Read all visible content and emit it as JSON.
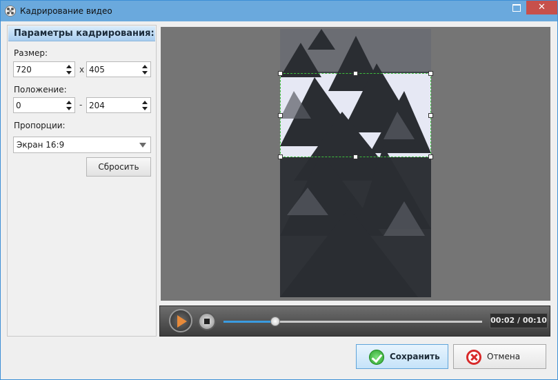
{
  "window": {
    "title": "Кадрирование видео",
    "icons": {
      "app": "film-reel-icon",
      "restore": "restore-window-icon",
      "close": "close-icon"
    }
  },
  "crop_panel": {
    "header": "Параметры кадрирования:",
    "size_label": "Размер:",
    "width": "720",
    "size_separator": "x",
    "height": "405",
    "position_label": "Положение:",
    "pos_x": "0",
    "position_separator": "-",
    "pos_y": "204",
    "ratio_label": "Пропорции:",
    "ratio_value": "Экран 16:9",
    "reset_label": "Сбросить"
  },
  "player": {
    "time": "00:02 / 00:10",
    "progress": 0.2
  },
  "footer": {
    "save_label": "Сохранить",
    "cancel_label": "Отмена"
  },
  "colors": {
    "titlebar": "#6aa9dd",
    "panel_header": "#a9cdef",
    "crop_border": "#3ec43e",
    "seek_fill": "#3a9be0",
    "close_button": "#c7504b"
  }
}
